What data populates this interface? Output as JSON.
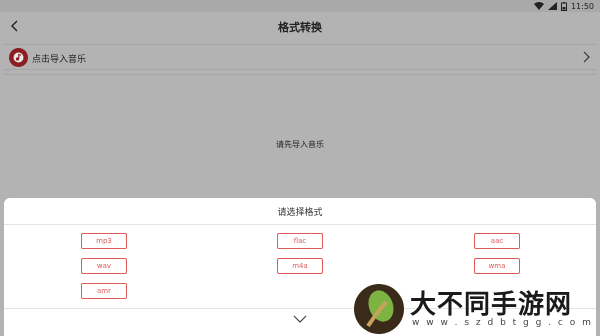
{
  "status": {
    "time": "11:50"
  },
  "header": {
    "title": "格式转换"
  },
  "import": {
    "label": "点击导入音乐"
  },
  "main": {
    "empty_text": "请先导入音乐"
  },
  "sheet": {
    "title": "请选择格式",
    "formats": [
      "mp3",
      "flac",
      "aac",
      "wav",
      "m4a",
      "wma",
      "amr"
    ]
  },
  "colors": {
    "accent": "#e05a5a",
    "music_icon": "#8c1e22"
  },
  "watermark": {
    "text": "大不同手游网",
    "url": "w w w . s z d b t g g . c o m"
  }
}
